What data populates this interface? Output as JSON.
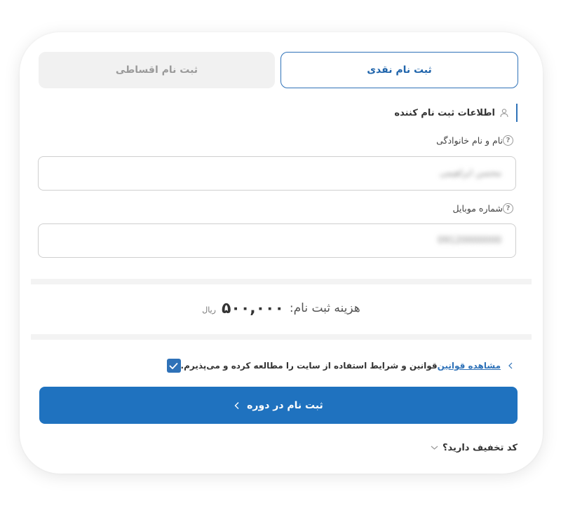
{
  "tabs": {
    "cash_label": "ثبت نام نقدی",
    "installment_label": "ثبت نام اقساطی"
  },
  "section": {
    "title": "اطلاعات ثبت نام کننده",
    "icon": "user-icon"
  },
  "fields": {
    "name_label": "نام و نام خانوادگی",
    "name_value": "محسن ابراهیمی",
    "mobile_label": "شماره موبایل",
    "mobile_value": "09120000000"
  },
  "price": {
    "label": "هزینه ثبت نام:",
    "value": "۵۰۰,۰۰۰",
    "unit": "ریال"
  },
  "terms": {
    "checked": true,
    "text": "قوانین و شرایط استفاده از سایت را مطالعه کرده و می‌پذیرم.",
    "link": "مشاهده قوانین"
  },
  "submit": {
    "label": "ثبت نام در دوره"
  },
  "discount": {
    "label": "کد تخفیف دارید؟"
  },
  "colors": {
    "accent": "#1f72bf",
    "tab_inactive_bg": "#f1f1f1"
  }
}
